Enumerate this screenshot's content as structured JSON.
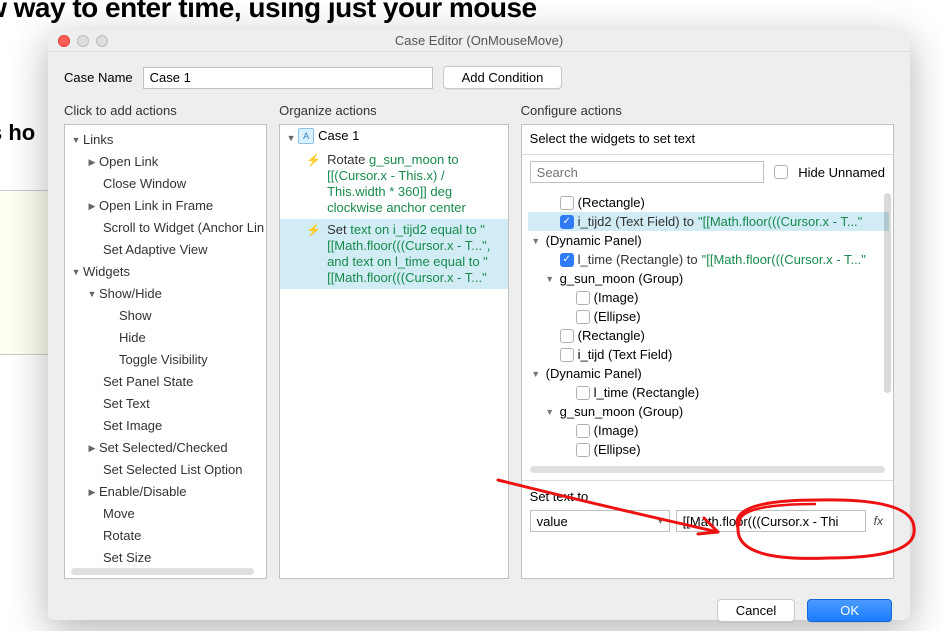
{
  "bg": {
    "heading": "ew way to enter time, using just your mouse",
    "side": "s ho"
  },
  "dialog": {
    "title": "Case Editor (OnMouseMove)",
    "case_name_label": "Case Name",
    "case_name_value": "Case 1",
    "add_condition": "Add Condition",
    "cancel": "Cancel",
    "ok": "OK"
  },
  "col_headers": {
    "actions": "Click to add actions",
    "organize": "Organize actions",
    "configure": "Configure actions"
  },
  "actions_tree": {
    "group_links": "Links",
    "open_link": "Open Link",
    "close_window": "Close Window",
    "open_frame": "Open Link in Frame",
    "scroll_widget": "Scroll to Widget (Anchor Lin",
    "set_adaptive": "Set Adaptive View",
    "group_widgets": "Widgets",
    "show_hide": "Show/Hide",
    "show": "Show",
    "hide": "Hide",
    "toggle_vis": "Toggle Visibility",
    "set_panel_state": "Set Panel State",
    "set_text": "Set Text",
    "set_image": "Set Image",
    "set_selected": "Set Selected/Checked",
    "set_list_option": "Set Selected List Option",
    "enable_disable": "Enable/Disable",
    "move": "Move",
    "rotate": "Rotate",
    "set_size": "Set Size"
  },
  "organize": {
    "case_name": "Case 1",
    "a1_word": "Rotate ",
    "a1_detail": "g_sun_moon to [[(Cursor.x - This.x) / This.width * 360]] deg clockwise anchor center",
    "a2_word": "Set ",
    "a2_detail": "text on i_tijd2 equal to \"[[Math.floor(((Cursor.x - T...\", and text on l_time equal to \"[[Math.floor(((Cursor.x - T...\""
  },
  "configure": {
    "prompt": "Select the widgets to set text",
    "search_placeholder": "Search",
    "hide_unnamed": "Hide Unnamed",
    "set_text_to": "Set text to",
    "value_select": "value",
    "value_input": "[[Math.floor(((Cursor.x - Thi",
    "fx": "fx"
  },
  "widgets": {
    "rectangle": "(Rectangle)",
    "i_tijd2_label": "i_tijd2 (Text Field) to ",
    "i_tijd2_value": "\"[[Math.floor(((Cursor.x - T...\"",
    "dyn_panel": "(Dynamic Panel)",
    "l_time_label": "l_time (Rectangle) to ",
    "l_time_value": "\"[[Math.floor(((Cursor.x - T...\"",
    "g_sun_moon": "g_sun_moon (Group)",
    "image": "(Image)",
    "ellipse": "(Ellipse)",
    "i_tijd": "i_tijd (Text Field)",
    "l_time_rect": "l_time (Rectangle)"
  }
}
